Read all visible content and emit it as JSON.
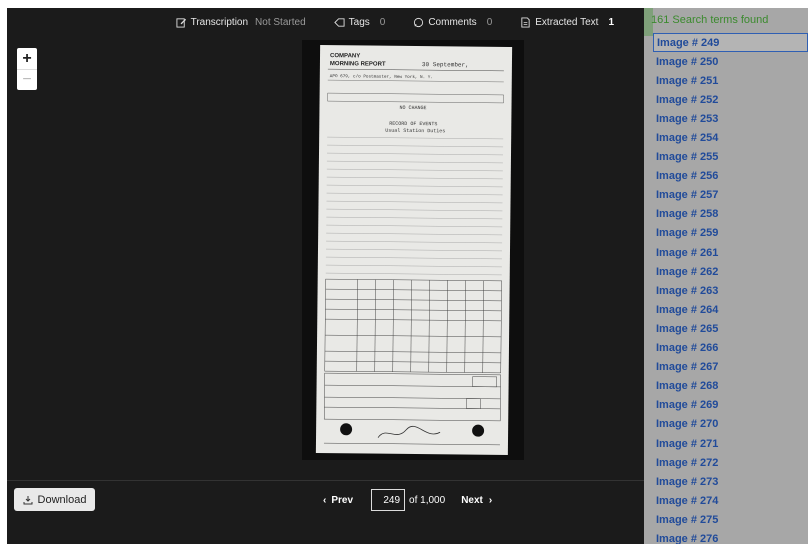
{
  "toolbar": {
    "transcription_label": "Transcription",
    "transcription_status": "Not Started",
    "tags_label": "Tags",
    "tags_count": "0",
    "comments_label": "Comments",
    "comments_count": "0",
    "extracted_label": "Extracted Text",
    "extracted_count": "1"
  },
  "zoom": {
    "in": "+",
    "out": "−"
  },
  "bottom": {
    "download_label": "Download",
    "prev_label": "Prev",
    "page_value": "249",
    "page_total": "of 1,000",
    "next_label": "Next"
  },
  "results": {
    "header": "161 Search terms found",
    "items": [
      "Image # 249",
      "Image # 250",
      "Image # 251",
      "Image # 252",
      "Image # 253",
      "Image # 254",
      "Image # 255",
      "Image # 256",
      "Image # 257",
      "Image # 258",
      "Image # 259",
      "Image # 261",
      "Image # 262",
      "Image # 263",
      "Image # 264",
      "Image # 265",
      "Image # 266",
      "Image # 267",
      "Image # 268",
      "Image # 269",
      "Image # 270",
      "Image # 271",
      "Image # 272",
      "Image # 273",
      "Image # 274",
      "Image # 275",
      "Image # 276"
    ]
  },
  "document": {
    "title_line1": "COMPANY",
    "title_line2": "MORNING REPORT",
    "date": "30 September,",
    "station": "APO 679, c/o Postmaster, New York, N. Y.",
    "remarks_header": "RECORD OF EVENTS",
    "event": "Usual Station Duties",
    "no_change": "NO CHANGE"
  }
}
